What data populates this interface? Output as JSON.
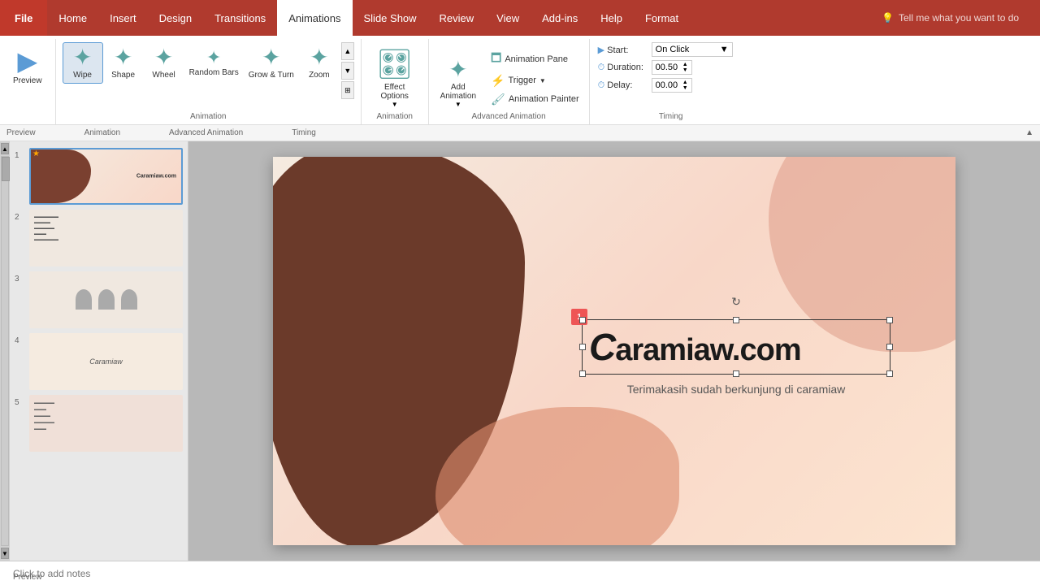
{
  "titlebar": {
    "file_label": "File",
    "tabs": [
      "Home",
      "Insert",
      "Design",
      "Transitions",
      "Animations",
      "Slide Show",
      "Review",
      "View",
      "Add-ins",
      "Help",
      "Format"
    ],
    "active_tab": "Animations",
    "search_placeholder": "Tell me what you want to do"
  },
  "ribbon": {
    "preview_label": "Preview",
    "animation_group_label": "Animation",
    "animations": [
      {
        "id": "wipe",
        "label": "Wipe",
        "active": true
      },
      {
        "id": "shape",
        "label": "Shape",
        "active": false
      },
      {
        "id": "wheel",
        "label": "Wheel",
        "active": false
      },
      {
        "id": "random-bars",
        "label": "Random Bars",
        "active": false
      },
      {
        "id": "grow-turn",
        "label": "Grow & Turn",
        "active": false
      },
      {
        "id": "zoom",
        "label": "Zoom",
        "active": false
      }
    ],
    "effect_options_label": "Effect Options",
    "advanced_group_label": "Advanced Animation",
    "animation_pane_label": "Animation Pane",
    "trigger_label": "Trigger",
    "add_animation_label": "Add Animation",
    "animation_painter_label": "Animation Painter",
    "timing_group_label": "Timing",
    "start_label": "Start:",
    "start_value": "On Click",
    "duration_label": "Duration:",
    "duration_value": "00.50",
    "delay_label": "Delay:",
    "delay_value": "00.00"
  },
  "strip": {
    "groups": [
      "Preview",
      "Animation",
      "Advanced Animation",
      "Timing"
    ]
  },
  "slides": [
    {
      "num": "1",
      "active": true,
      "has_star": true
    },
    {
      "num": "2",
      "active": false,
      "has_star": false
    },
    {
      "num": "3",
      "active": false,
      "has_star": false
    },
    {
      "num": "4",
      "active": false,
      "has_star": false
    },
    {
      "num": "5",
      "active": false,
      "has_star": false
    }
  ],
  "slide": {
    "main_text": "Caramiaw.com",
    "sub_text": "Terimakasih sudah berkunjung di caramiaw",
    "animation_badge": "1"
  },
  "notes": {
    "placeholder": "Click to add notes"
  }
}
